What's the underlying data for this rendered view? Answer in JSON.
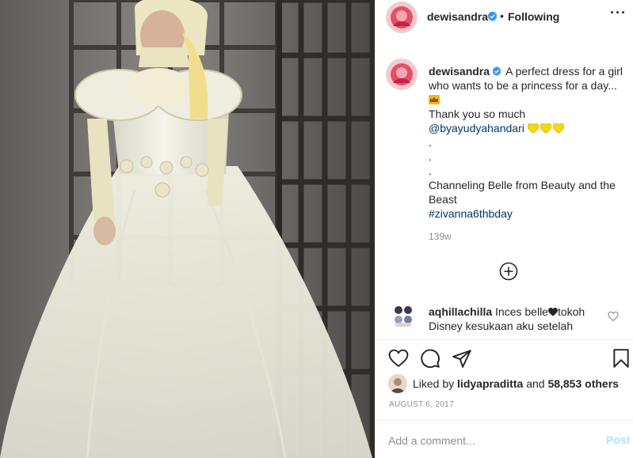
{
  "post": {
    "username": "dewisandra",
    "follow_state": "Following",
    "separator": "•",
    "more_label": "···"
  },
  "caption": {
    "username": "dewisandra",
    "line1": "A perfect dress for a girl",
    "line2": "who wants to be a princess for a day...",
    "line3": "Thank you so much",
    "mention": "@byayudyahandari",
    "dot1": ".",
    "dot2": ".",
    "dot3": ".",
    "line4": "Channeling Belle from Beauty and the",
    "line5": "Beast",
    "hashtag": "#zivanna6thbday",
    "time_ago": "139w"
  },
  "comment": {
    "username": "aqhillachilla",
    "text1": "Inces belle",
    "text1b": "tokoh",
    "text2": "Disney kesukaan aku setelah"
  },
  "likes": {
    "prefix": "Liked by",
    "user": "lidyapraditta",
    "conj": "and",
    "others": "58,853 others"
  },
  "date": "AUGUST 6, 2017",
  "add_comment": {
    "placeholder": "Add a comment...",
    "post_label": "Post"
  },
  "icons": {
    "verified": "verified-badge-icon",
    "crown": "crown-icon",
    "heart": "heart-icon",
    "comment": "comment-icon",
    "share": "share-icon",
    "save": "bookmark-icon",
    "load_more": "plus-circle-icon"
  },
  "colors": {
    "accent_link": "#00376b",
    "verified_blue": "#3897f0",
    "post_disabled": "#b2dffc",
    "yellow_heart": "#f5d90a"
  }
}
